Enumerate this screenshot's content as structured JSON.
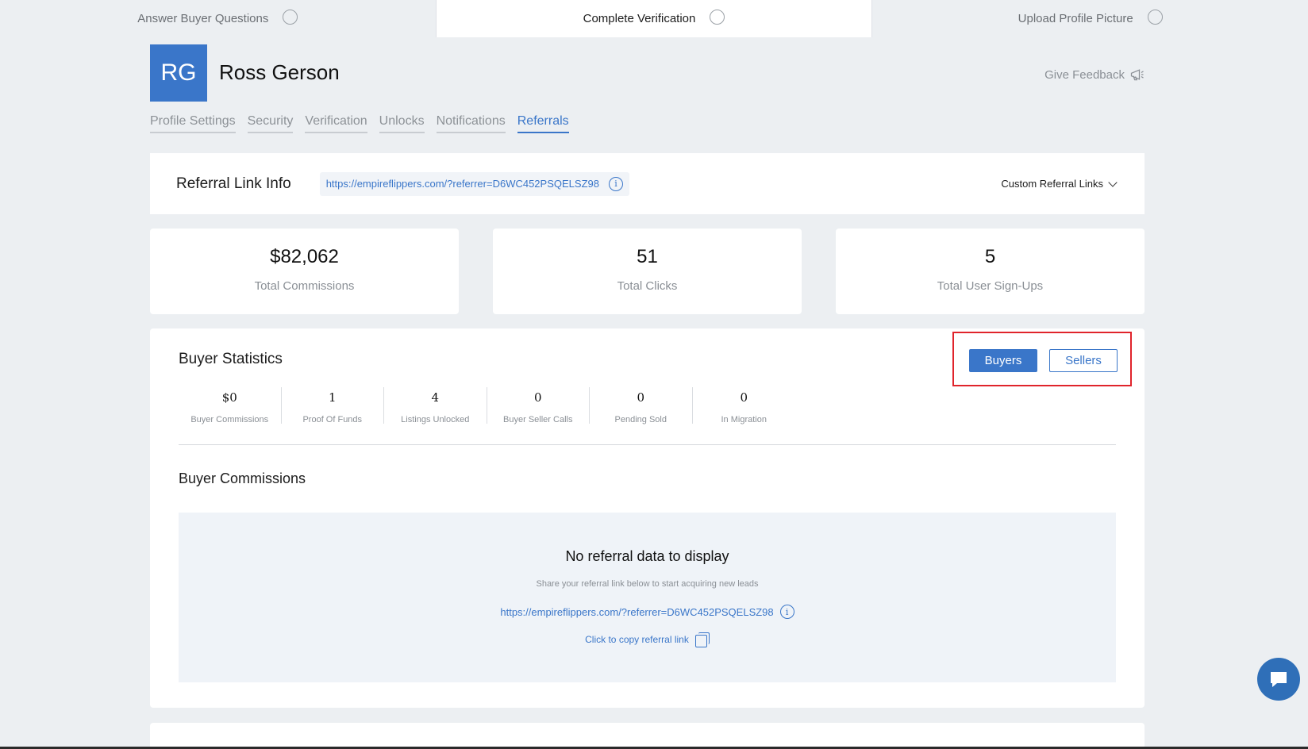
{
  "steps": [
    {
      "label": "Answer Buyer Questions",
      "active": false
    },
    {
      "label": "Complete Verification",
      "active": true
    },
    {
      "label": "Upload Profile Picture",
      "active": false
    }
  ],
  "profile": {
    "initials": "RG",
    "name": "Ross Gerson",
    "avatar_color": "#3a76c9"
  },
  "feedback": {
    "label": "Give Feedback",
    "icon": "megaphone-icon"
  },
  "tabs": [
    {
      "label": "Profile Settings"
    },
    {
      "label": "Security"
    },
    {
      "label": "Verification"
    },
    {
      "label": "Unlocks"
    },
    {
      "label": "Notifications"
    },
    {
      "label": "Referrals",
      "active": true
    }
  ],
  "referral_link": {
    "title": "Referral Link Info",
    "url": "https://empireflippers.com/?referrer=D6WC452PSQELSZ98",
    "custom_links_label": "Custom Referral Links"
  },
  "stats": [
    {
      "value": "$82,062",
      "label": "Total Commissions"
    },
    {
      "value": "51",
      "label": "Total Clicks"
    },
    {
      "value": "5",
      "label": "Total User Sign-Ups"
    }
  ],
  "buyer_statistics": {
    "title": "Buyer Statistics",
    "toggle": {
      "buyers_label": "Buyers",
      "sellers_label": "Sellers",
      "selected": "Buyers"
    },
    "metrics": [
      {
        "value": "$0",
        "label": "Buyer Commissions"
      },
      {
        "value": "1",
        "label": "Proof Of Funds"
      },
      {
        "value": "4",
        "label": "Listings Unlocked"
      },
      {
        "value": "0",
        "label": "Buyer Seller Calls"
      },
      {
        "value": "0",
        "label": "Pending Sold"
      },
      {
        "value": "0",
        "label": "In Migration"
      }
    ]
  },
  "buyer_commissions": {
    "title": "Buyer Commissions",
    "empty_title": "No referral data to display",
    "empty_sub": "Share your referral link below to start acquiring new leads",
    "url": "https://empireflippers.com/?referrer=D6WC452PSQELSZ98",
    "copy_label": "Click to copy referral link"
  },
  "colors": {
    "accent": "#3a76c9",
    "highlight_border": "#e0242b",
    "background": "#eceff2"
  }
}
